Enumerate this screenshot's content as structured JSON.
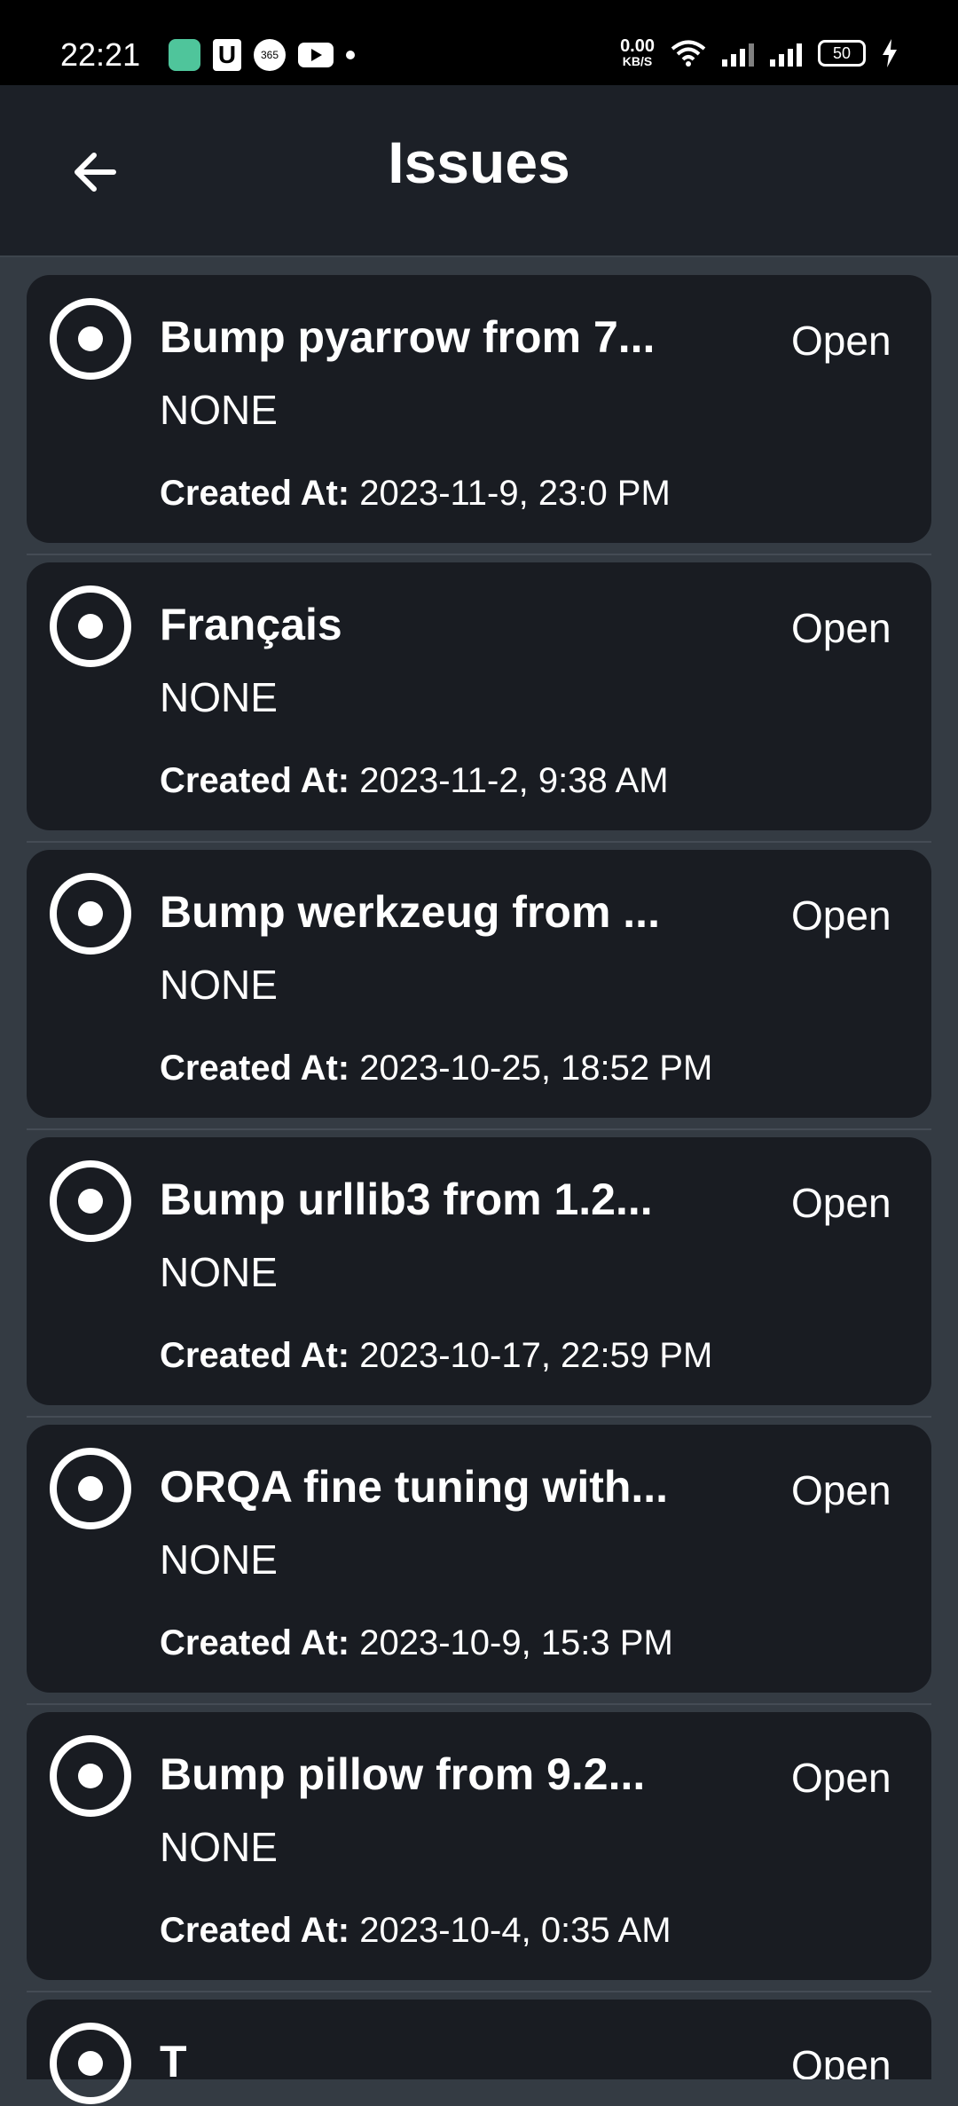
{
  "status_bar": {
    "time": "22:21",
    "net_speed_value": "0.00",
    "net_speed_unit": "KB/S",
    "battery": "50"
  },
  "header": {
    "title": "Issues"
  },
  "issues": [
    {
      "title": "Bump pyarrow from 7...",
      "state": "Open",
      "label": "NONE",
      "created_label": "Created At:",
      "created_value": " 2023-11-9, 23:0 PM"
    },
    {
      "title": "Français",
      "state": "Open",
      "label": "NONE",
      "created_label": "Created At:",
      "created_value": " 2023-11-2, 9:38 AM"
    },
    {
      "title": "Bump werkzeug from ...",
      "state": "Open",
      "label": "NONE",
      "created_label": "Created At:",
      "created_value": " 2023-10-25, 18:52 PM"
    },
    {
      "title": "Bump urllib3 from 1.2...",
      "state": "Open",
      "label": "NONE",
      "created_label": "Created At:",
      "created_value": " 2023-10-17, 22:59 PM"
    },
    {
      "title": "ORQA fine tuning with...",
      "state": "Open",
      "label": "NONE",
      "created_label": "Created At:",
      "created_value": " 2023-10-9, 15:3 PM"
    },
    {
      "title": "Bump pillow from 9.2...",
      "state": "Open",
      "label": "NONE",
      "created_label": "Created At:",
      "created_value": " 2023-10-4, 0:35 AM"
    },
    {
      "title": "T",
      "state": "Open",
      "label": "",
      "created_label": "",
      "created_value": ""
    }
  ],
  "icons": {
    "back": "arrow-left-icon",
    "issue": "issue-open-icon"
  },
  "colors": {
    "background": "#343b43",
    "card": "#191c22",
    "appbar": "#1c2027",
    "text": "#ffffff"
  }
}
